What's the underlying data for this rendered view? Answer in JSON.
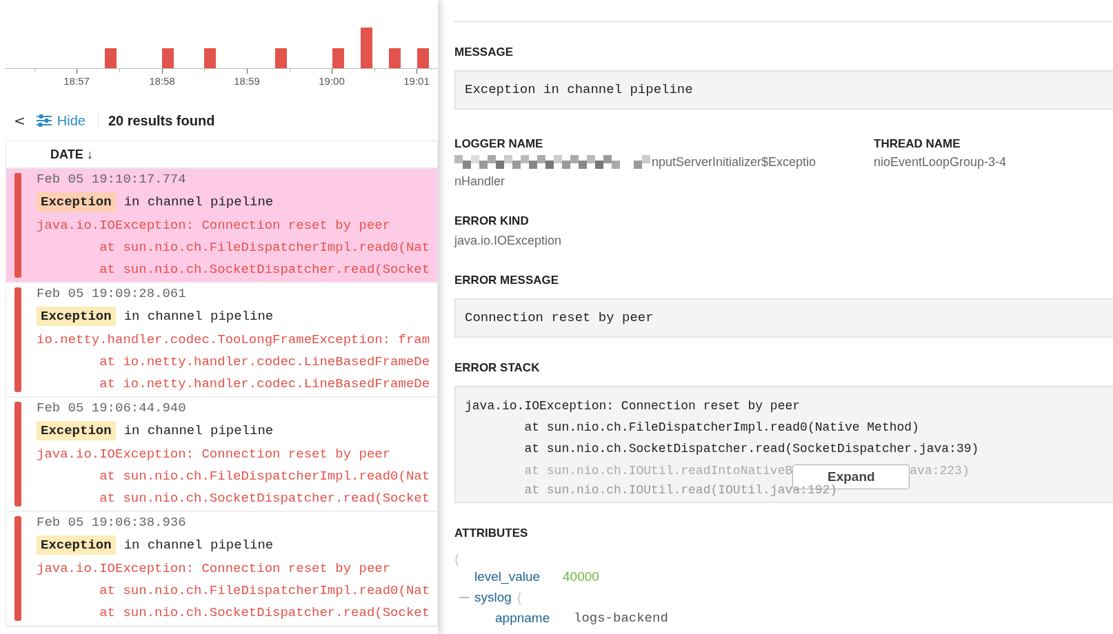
{
  "histogram": {
    "time_labels": [
      "18:57",
      "18:58",
      "18:59",
      "19:00",
      "19:01"
    ]
  },
  "toolbar": {
    "back": "<",
    "hide_label": "Hide",
    "results": "20 results found"
  },
  "table": {
    "columns": [
      {
        "label": "DATE ↓"
      }
    ],
    "rows": [
      {
        "date": "Feb 05 19:10:17.774",
        "tag": "Exception",
        "message": "in channel pipeline",
        "selected": true,
        "trace": [
          "java.io.IOException: Connection reset by peer",
          "        at sun.nio.ch.FileDispatcherImpl.read0(Nat",
          "        at sun.nio.ch.SocketDispatcher.read(Socket"
        ]
      },
      {
        "date": "Feb 05 19:09:28.061",
        "tag": "Exception",
        "message": "in channel pipeline",
        "selected": false,
        "trace": [
          "io.netty.handler.codec.TooLongFrameException: fram",
          "        at io.netty.handler.codec.LineBasedFrameDe",
          "        at io.netty.handler.codec.LineBasedFrameDe"
        ]
      },
      {
        "date": "Feb 05 19:06:44.940",
        "tag": "Exception",
        "message": "in channel pipeline",
        "selected": false,
        "trace": [
          "java.io.IOException: Connection reset by peer",
          "        at sun.nio.ch.FileDispatcherImpl.read0(Nat",
          "        at sun.nio.ch.SocketDispatcher.read(Socket"
        ]
      },
      {
        "date": "Feb 05 19:06:38.936",
        "tag": "Exception",
        "message": "in channel pipeline",
        "selected": false,
        "trace": [
          "java.io.IOException: Connection reset by peer",
          "        at sun.nio.ch.FileDispatcherImpl.read0(Nat",
          "        at sun.nio.ch.SocketDispatcher.read(Socket"
        ]
      }
    ]
  },
  "details": {
    "message": {
      "label": "MESSAGE",
      "value": "Exception in channel pipeline"
    },
    "logger_name": {
      "label": "LOGGER NAME",
      "lines": [
        "nputServerInitializer$Exceptio",
        "nHandler"
      ]
    },
    "thread_name": {
      "label": "THREAD NAME",
      "value": "nioEventLoopGroup-3-4"
    },
    "error_kind": {
      "label": "ERROR KIND",
      "value": "java.io.IOException"
    },
    "error_message": {
      "label": "ERROR MESSAGE",
      "value": "Connection reset by peer"
    },
    "error_stack": {
      "label": "ERROR STACK",
      "lines": [
        "java.io.IOException: Connection reset by peer",
        "        at sun.nio.ch.FileDispatcherImpl.read0(Native Method)",
        "        at sun.nio.ch.SocketDispatcher.read(SocketDispatcher.java:39)"
      ],
      "faded_line_start": "        at sun.nio.ch.IOUtil.readIntoNativeB",
      "faded_line_end": "ava:223)",
      "last_line": "        at sun.nio.ch.IOUtil.read(IOUtil.java:192)",
      "expand_button": "Expand"
    },
    "attributes": {
      "label": "ATTRIBUTES",
      "open_brace": "{",
      "children": [
        {
          "key": "level_value",
          "value": "40000",
          "kind": "number"
        },
        {
          "key": "syslog",
          "kind": "object",
          "expanded": true,
          "brace": "{",
          "children": [
            {
              "key": "appname",
              "value": "logs-backend",
              "kind": "string"
            }
          ]
        }
      ]
    }
  }
}
